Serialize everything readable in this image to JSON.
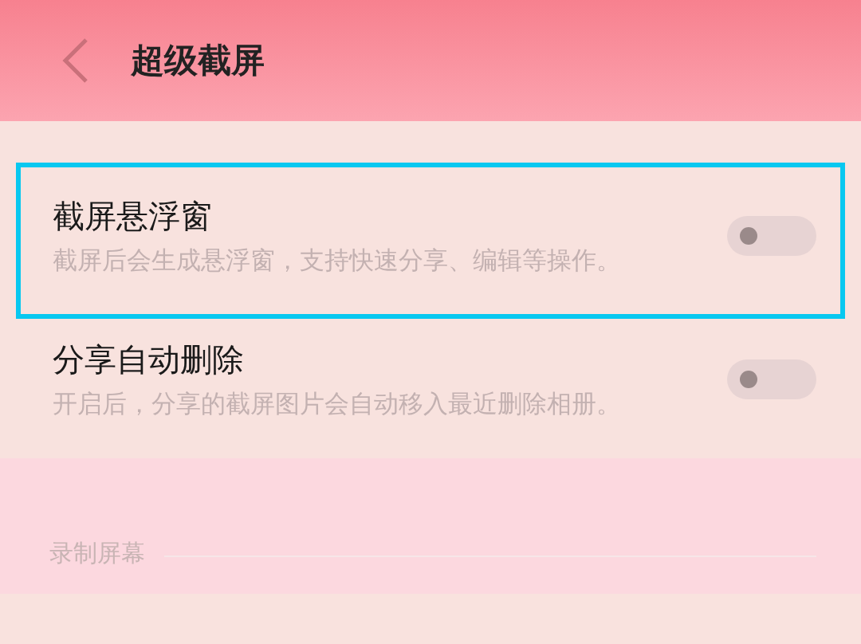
{
  "header": {
    "title": "超级截屏"
  },
  "items": [
    {
      "title": "截屏悬浮窗",
      "description": "截屏后会生成悬浮窗，支持快速分享、编辑等操作。",
      "on": false,
      "highlighted": true
    },
    {
      "title": "分享自动删除",
      "description": "开启后，分享的截屏图片会自动移入最近删除相册。",
      "on": false,
      "highlighted": false
    }
  ],
  "section": {
    "title": "录制屏幕"
  }
}
